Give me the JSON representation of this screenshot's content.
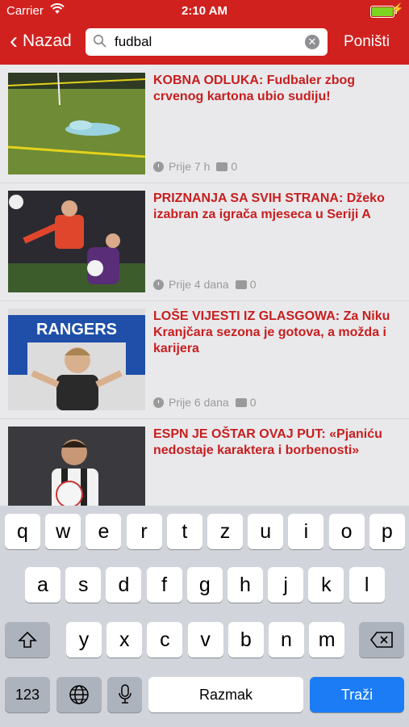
{
  "status_bar": {
    "carrier": "Carrier",
    "time": "2:10 AM",
    "wifi_icon": "wifi-icon",
    "battery_icon": "battery-icon"
  },
  "nav": {
    "back_label": "Nazad",
    "search_value": "fudbal",
    "cancel_label": "Poništi",
    "brand_color": "#d0211f"
  },
  "articles": [
    {
      "title": "KOBNA ODLUKA: Fudbaler zbog crvenog kartona ubio sudiju!",
      "time": "Prije 7 h",
      "comments": "0"
    },
    {
      "title": "PRIZNANJA SA SVIH STRANA: Džeko izabran za igrača mjeseca u Seriji A",
      "time": "Prije 4 dana",
      "comments": "0"
    },
    {
      "title": "LOŠE VIJESTI IZ GLASGOWA: Za Niku Kranjčara sezona je gotova, a možda i karijera",
      "time": "Prije 6 dana",
      "comments": "0"
    },
    {
      "title": "ESPN JE OŠTAR OVAJ PUT: «Pjaniću nedostaje karaktera i borbenosti»",
      "time": "",
      "comments": ""
    }
  ],
  "thumb_text": {
    "rangers": "RANGERS"
  },
  "keyboard": {
    "row1": [
      "q",
      "w",
      "e",
      "r",
      "t",
      "z",
      "u",
      "i",
      "o",
      "p"
    ],
    "row2": [
      "a",
      "s",
      "d",
      "f",
      "g",
      "h",
      "j",
      "k",
      "l"
    ],
    "row3": [
      "y",
      "x",
      "c",
      "v",
      "b",
      "n",
      "m"
    ],
    "numbers_label": "123",
    "space_label": "Razmak",
    "go_label": "Traži",
    "accent_color": "#1b7cf6"
  }
}
